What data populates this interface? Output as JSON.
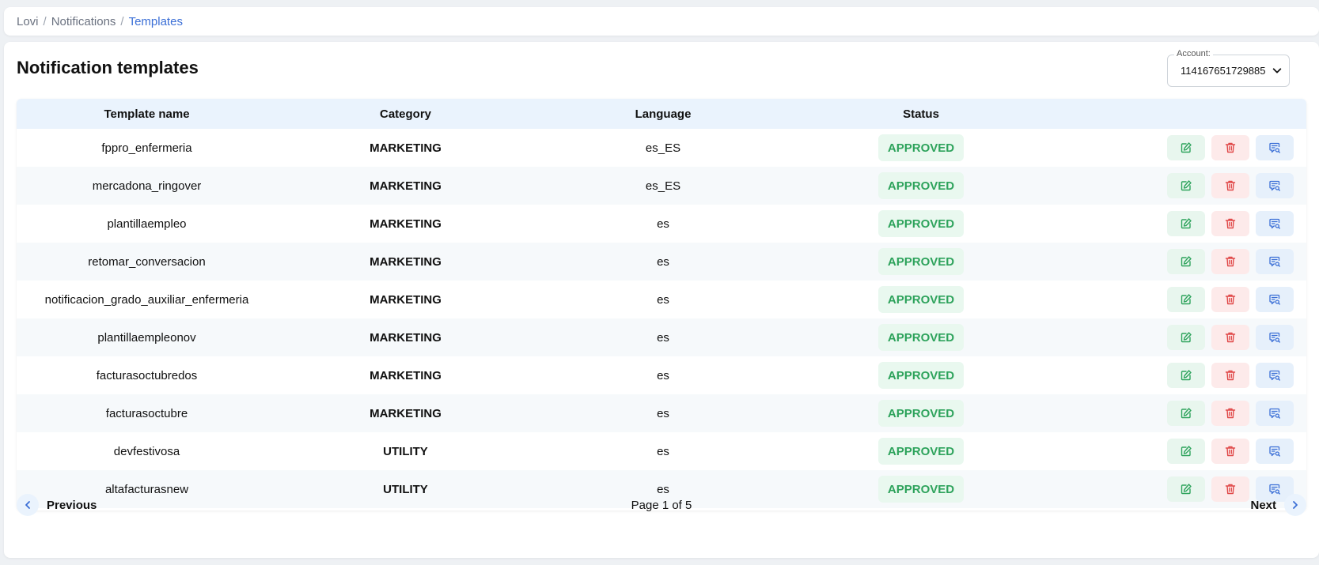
{
  "breadcrumb": [
    "Lovi",
    "Notifications",
    "Templates"
  ],
  "page_title": "Notification templates",
  "account": {
    "label": "Account:",
    "value": "114167651729885"
  },
  "table": {
    "headers": {
      "name": "Template name",
      "category": "Category",
      "language": "Language",
      "status": "Status"
    },
    "rows": [
      {
        "name": "fppro_enfermeria",
        "category": "MARKETING",
        "language": "es_ES",
        "status": "APPROVED"
      },
      {
        "name": "mercadona_ringover",
        "category": "MARKETING",
        "language": "es_ES",
        "status": "APPROVED"
      },
      {
        "name": "plantillaempleo",
        "category": "MARKETING",
        "language": "es",
        "status": "APPROVED"
      },
      {
        "name": "retomar_conversacion",
        "category": "MARKETING",
        "language": "es",
        "status": "APPROVED"
      },
      {
        "name": "notificacion_grado_auxiliar_enfermeria",
        "category": "MARKETING",
        "language": "es",
        "status": "APPROVED"
      },
      {
        "name": "plantillaempleonov",
        "category": "MARKETING",
        "language": "es",
        "status": "APPROVED"
      },
      {
        "name": "facturasoctubredos",
        "category": "MARKETING",
        "language": "es",
        "status": "APPROVED"
      },
      {
        "name": "facturasoctubre",
        "category": "MARKETING",
        "language": "es",
        "status": "APPROVED"
      },
      {
        "name": "devfestivosa",
        "category": "UTILITY",
        "language": "es",
        "status": "APPROVED"
      },
      {
        "name": "altafacturasnew",
        "category": "UTILITY",
        "language": "es",
        "status": "APPROVED"
      }
    ]
  },
  "actions": {
    "edit_icon": "edit-icon",
    "delete_icon": "trash-icon",
    "view_icon": "message-search-icon"
  },
  "pagination": {
    "previous": "Previous",
    "next": "Next",
    "info": "Page 1 of 5"
  },
  "colors": {
    "accent": "#3b6fd6",
    "status_green": "#2ea35c",
    "delete_red": "#e04848",
    "header_bg": "#eaf3fd"
  }
}
